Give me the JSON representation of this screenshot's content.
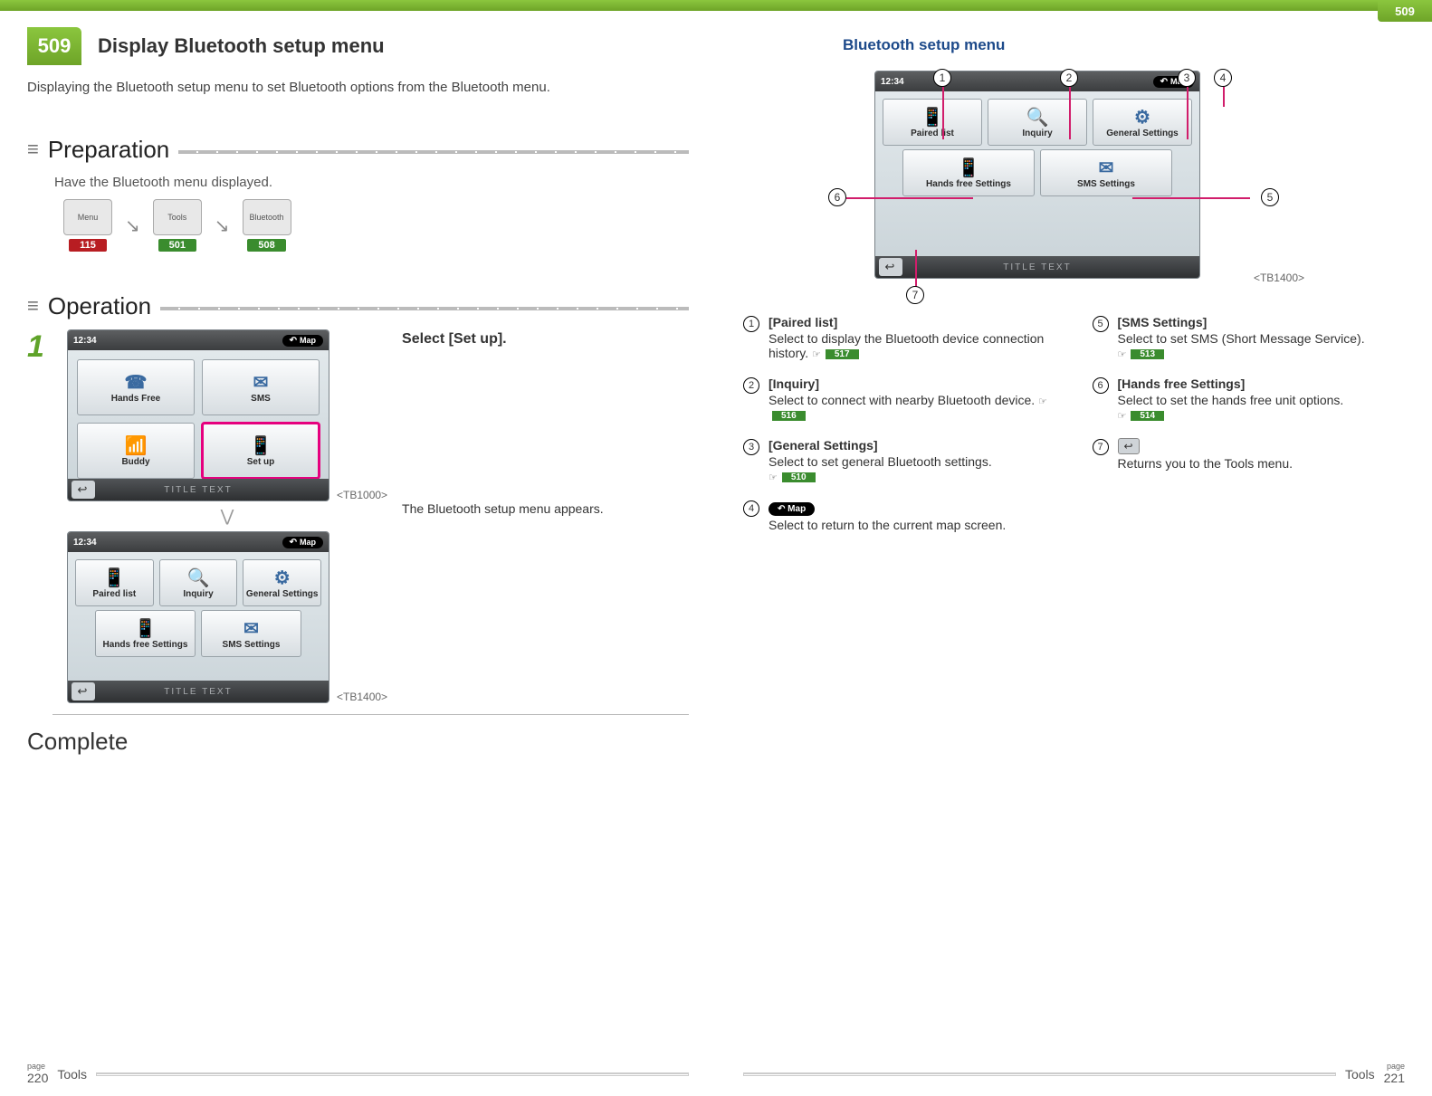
{
  "section_number": "509",
  "title": "Display Bluetooth setup menu",
  "intro": "Displaying the Bluetooth setup menu to set Bluetooth options from the Bluetooth menu.",
  "preparation": {
    "heading": "Preparation",
    "instruction": "Have the Bluetooth menu displayed.",
    "path": [
      {
        "label": "Menu",
        "ref": "115",
        "ref_style": "red"
      },
      {
        "label": "Tools",
        "ref": "501",
        "ref_style": "green"
      },
      {
        "label": "Bluetooth",
        "ref": "508",
        "ref_style": "green"
      }
    ]
  },
  "operation": {
    "heading": "Operation",
    "step_number": "1",
    "step_title": "Select [Set up].",
    "result_text": "The Bluetooth setup menu appears.",
    "screen1_label": "<TB1000>",
    "screen2_label": "<TB1400>",
    "screen1_tiles": [
      "Hands Free",
      "SMS",
      "Buddy",
      "Set up"
    ],
    "screen1_selected": 3,
    "screen2_tiles_top": [
      "Paired list",
      "Inquiry",
      "General Settings"
    ],
    "screen2_tiles_bottom": [
      "Hands free Settings",
      "SMS Settings"
    ],
    "footer_text": "TITLE TEXT",
    "clock": "12:34",
    "map_label": "Map"
  },
  "complete": "Complete",
  "right": {
    "subheading": "Bluetooth setup menu",
    "diagram_label": "<TB1400>",
    "callouts": [
      {
        "n": "1",
        "title": "[Paired list]",
        "text": "Select to display the Bluetooth device connection history.",
        "ref": "517"
      },
      {
        "n": "2",
        "title": "[Inquiry]",
        "text": "Select to connect with nearby Bluetooth device.",
        "ref": "516"
      },
      {
        "n": "3",
        "title": "[General Settings]",
        "text": "Select to set general Bluetooth settings.",
        "ref": "510"
      },
      {
        "n": "4",
        "title_icon": "map",
        "text": "Select to return to the current map screen."
      },
      {
        "n": "5",
        "title": "[SMS Settings]",
        "text": "Select to set SMS (Short Message Service).",
        "ref": "513"
      },
      {
        "n": "6",
        "title": "[Hands free Settings]",
        "text": "Select to set the hands free unit options.",
        "ref": "514"
      },
      {
        "n": "7",
        "title_icon": "back",
        "text": "Returns you to the Tools menu."
      }
    ],
    "map_label": "Map"
  },
  "footer": {
    "left_page": "220",
    "right_page": "221",
    "page_word": "page",
    "chapter": "Tools"
  }
}
